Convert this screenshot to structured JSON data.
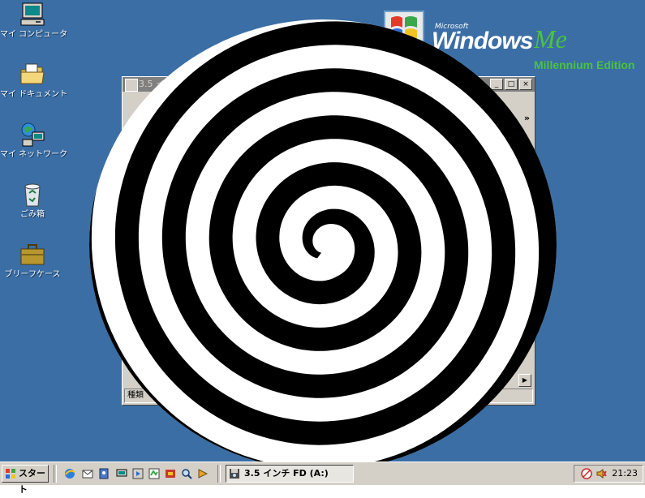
{
  "desktop": {
    "icons": [
      {
        "label": "マイ コンピュータ",
        "icon": "my-computer-icon"
      },
      {
        "label": "マイ ドキュメント",
        "icon": "my-documents-icon"
      },
      {
        "label": "マイ ネットワーク",
        "icon": "network-icon"
      },
      {
        "label": "ごみ箱",
        "icon": "recycle-bin-icon"
      },
      {
        "label": "ブリーフケース",
        "icon": "briefcase-icon"
      }
    ],
    "background_color": "#3a6ea5"
  },
  "logo": {
    "microsoft": "Microsoft",
    "windows": "Windows",
    "me": "Me",
    "edition": "Millennium Edition"
  },
  "window": {
    "title": "3.5 イ",
    "status": "種類",
    "minimize": "_",
    "maximize": "□",
    "close": "×",
    "chevron": "»"
  },
  "taskbar": {
    "start_label": "スタート",
    "task_label": "3.5 インチ FD (A:)",
    "clock": "21:23"
  }
}
